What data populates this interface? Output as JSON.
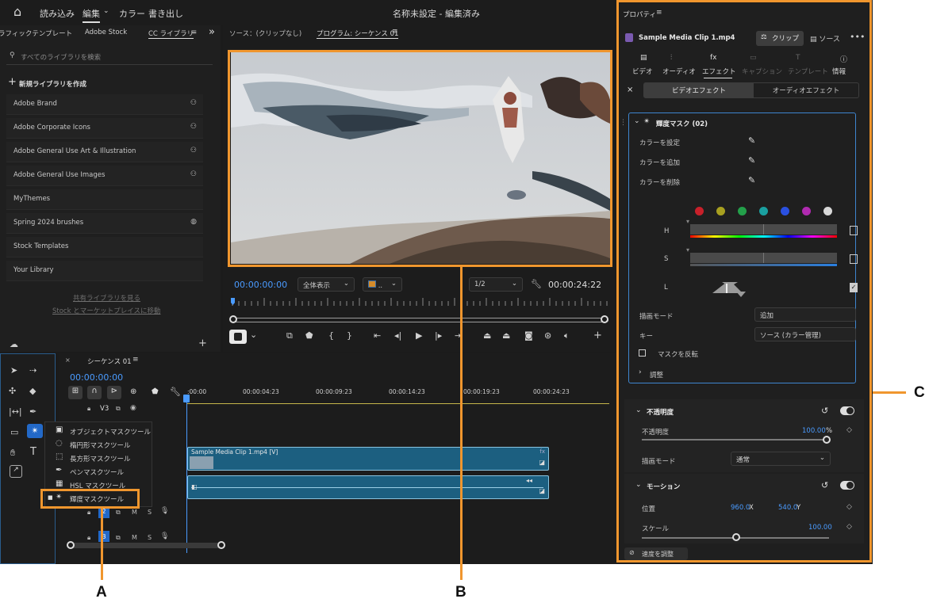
{
  "topbar": {
    "home": "⌂",
    "import": "読み込み",
    "edit": "編集",
    "color": "カラー",
    "export": "書き出し",
    "title": "名称未設定 - 編集済み"
  },
  "library": {
    "tabs": [
      "ラフィックテンプレート",
      "Adobe Stock",
      "CC ライブラリ",
      "≡"
    ],
    "search_placeholder": "すべてのライブラリを検索",
    "create_label": "新規ライブラリを作成",
    "items": [
      {
        "label": "Adobe Brand",
        "icon": "⚇"
      },
      {
        "label": "Adobe Corporate Icons",
        "icon": "⚇"
      },
      {
        "label": "Adobe General Use Art & Illustration",
        "icon": "⚇"
      },
      {
        "label": "Adobe General Use Images",
        "icon": "⚇"
      },
      {
        "label": "MyThemes",
        "icon": ""
      },
      {
        "label": "Spring 2024 brushes",
        "icon": "◍"
      },
      {
        "label": "Stock Templates",
        "icon": ""
      },
      {
        "label": "Your Library",
        "icon": ""
      }
    ],
    "link1": "共有ライブラリを見る",
    "link2": "Stock とマーケットプレイスに移動"
  },
  "monitor": {
    "tab_source": "ソース：(クリップなし)",
    "tab_program": "プログラム: シーケンス 01",
    "tab_menu": "≡",
    "timecode": "00:00:00:00",
    "zoom": "全体表示",
    "resolution": "1/2",
    "duration": "00:00:24:22"
  },
  "timeline": {
    "tab": "シーケンス 01",
    "timecode": "00:00:00:00",
    "ruler": [
      ":00:00",
      "00:00:04:23",
      "00:00:09:23",
      "00:00:14:23",
      "00:00:19:23",
      "00:00:24:23"
    ],
    "v3": "V3",
    "clip_video": "Sample Media Clip 1.mp4 [V]",
    "track_a2": "2",
    "track_a3": "3",
    "m": "M",
    "s": "S"
  },
  "mask_menu": {
    "items": [
      "オブジェクトマスクツール",
      "楕円形マスクツール",
      "長方形マスクツール",
      "ペンマスクツール",
      "HSL マスクツール",
      "輝度マスクツール"
    ]
  },
  "properties": {
    "title": "プロパティ",
    "menu": "≡",
    "clip_name": "Sample Media Clip 1.mp4",
    "btn_clip": "クリップ",
    "btn_source": "ソース",
    "cat_tabs": [
      "ビデオ",
      "オーディオ",
      "エフェクト",
      "キャプション",
      "テンプレート",
      "情報"
    ],
    "seg_video": "ビデオエフェクト",
    "seg_audio": "オーディオエフェクト",
    "effect_name": "輝度マスク (02)",
    "set_color": "カラーを設定",
    "add_color": "カラーを追加",
    "remove_color": "カラーを削除",
    "h": "H",
    "s": "S",
    "l": "L",
    "blend_label": "描画モード",
    "blend_value": "追加",
    "key_label": "キー",
    "key_value": "ソース (カラー管理)",
    "invert": "マスクを反転",
    "adjust": "調整",
    "opacity_section": "不透明度",
    "opacity_label": "不透明度",
    "opacity_value": "100.00",
    "percent": "%",
    "blend2_label": "描画モード",
    "blend2_value": "通常",
    "motion_section": "モーション",
    "position_label": "位置",
    "pos_x": "960.0",
    "pos_x_unit": "X",
    "pos_y": "540.0",
    "pos_y_unit": "Y",
    "scale_label": "スケール",
    "scale_value": "100.00",
    "speed": "速度を調整",
    "swatches": [
      "#c8202a",
      "#a8a020",
      "#23a04a",
      "#1aa0a0",
      "#2a50e0",
      "#b02ab0",
      "#d8d8d8"
    ]
  },
  "callouts": {
    "a": "A",
    "b": "B",
    "c": "C"
  }
}
